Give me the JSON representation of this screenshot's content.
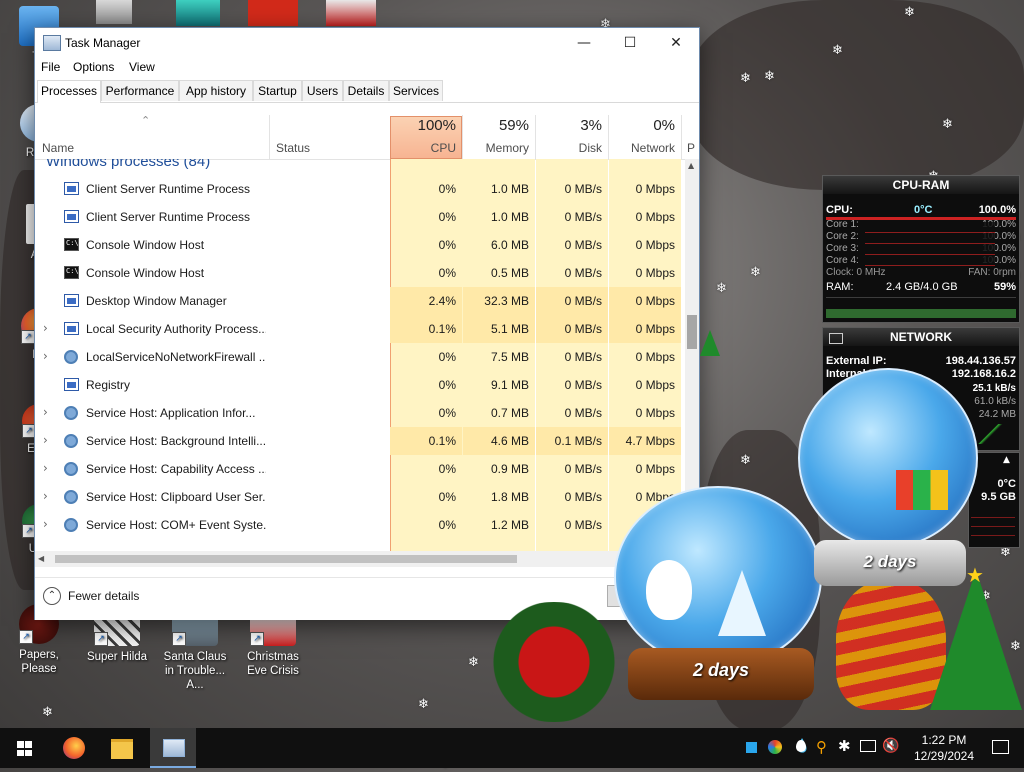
{
  "desktop": {
    "icons": [
      {
        "label": "Th",
        "name": "this-pc"
      },
      {
        "label": "Recy",
        "name": "recycle-bin"
      },
      {
        "label": "Act",
        "name": "activate"
      },
      {
        "label": "Fir",
        "name": "firefox"
      },
      {
        "label": "Ever",
        "name": "everything"
      },
      {
        "label": "Unc",
        "name": "unc"
      },
      {
        "label": "Papers, Please",
        "name": "papers-please"
      },
      {
        "label": "Super Hilda",
        "name": "super-hilda"
      },
      {
        "label": "Santa Claus in Trouble... A...",
        "name": "santa-claus-in-trouble"
      },
      {
        "label": "Christmas Eve Crisis",
        "name": "christmas-eve-crisis"
      }
    ]
  },
  "task_manager": {
    "title": "Task Manager",
    "menu": [
      "File",
      "Options",
      "View"
    ],
    "tabs": [
      "Processes",
      "Performance",
      "App history",
      "Startup",
      "Users",
      "Details",
      "Services"
    ],
    "active_tab": "Processes",
    "columns": {
      "name": "Name",
      "status": "Status",
      "cpu": {
        "pct": "100%",
        "label": "CPU"
      },
      "memory": {
        "pct": "59%",
        "label": "Memory"
      },
      "disk": {
        "pct": "3%",
        "label": "Disk"
      },
      "network": {
        "pct": "0%",
        "label": "Network"
      },
      "overflow": "P"
    },
    "group_title": "Windows processes (84)",
    "rows": [
      {
        "name": "Client Server Runtime Process",
        "icon": "window-icon",
        "expand": false,
        "cpu": "0%",
        "memory": "1.0 MB",
        "disk": "0 MB/s",
        "network": "0 Mbps"
      },
      {
        "name": "Client Server Runtime Process",
        "icon": "window-icon",
        "expand": false,
        "cpu": "0%",
        "memory": "1.0 MB",
        "disk": "0 MB/s",
        "network": "0 Mbps"
      },
      {
        "name": "Console Window Host",
        "icon": "console-icon",
        "expand": false,
        "cpu": "0%",
        "memory": "6.0 MB",
        "disk": "0 MB/s",
        "network": "0 Mbps"
      },
      {
        "name": "Console Window Host",
        "icon": "console-icon",
        "expand": false,
        "cpu": "0%",
        "memory": "0.5 MB",
        "disk": "0 MB/s",
        "network": "0 Mbps"
      },
      {
        "name": "Desktop Window Manager",
        "icon": "window-icon",
        "expand": false,
        "cpu": "2.4%",
        "memory": "32.3 MB",
        "disk": "0 MB/s",
        "network": "0 Mbps"
      },
      {
        "name": "Local Security Authority Process...",
        "icon": "window-icon",
        "expand": true,
        "cpu": "0.1%",
        "memory": "5.1 MB",
        "disk": "0 MB/s",
        "network": "0 Mbps"
      },
      {
        "name": "LocalServiceNoNetworkFirewall ...",
        "icon": "gear-icon",
        "expand": true,
        "cpu": "0%",
        "memory": "7.5 MB",
        "disk": "0 MB/s",
        "network": "0 Mbps"
      },
      {
        "name": "Registry",
        "icon": "window-icon",
        "expand": false,
        "cpu": "0%",
        "memory": "9.1 MB",
        "disk": "0 MB/s",
        "network": "0 Mbps"
      },
      {
        "name": "Service Host: Application Infor...",
        "icon": "gear-icon",
        "expand": true,
        "cpu": "0%",
        "memory": "0.7 MB",
        "disk": "0 MB/s",
        "network": "0 Mbps"
      },
      {
        "name": "Service Host: Background Intelli...",
        "icon": "gear-icon",
        "expand": true,
        "cpu": "0.1%",
        "memory": "4.6 MB",
        "disk": "0.1 MB/s",
        "network": "4.7 Mbps"
      },
      {
        "name": "Service Host: Capability Access ...",
        "icon": "gear-icon",
        "expand": true,
        "cpu": "0%",
        "memory": "0.9 MB",
        "disk": "0 MB/s",
        "network": "0 Mbps"
      },
      {
        "name": "Service Host: Clipboard User Ser...",
        "icon": "gear-icon",
        "expand": true,
        "cpu": "0%",
        "memory": "1.8 MB",
        "disk": "0 MB/s",
        "network": "0 Mbps"
      },
      {
        "name": "Service Host: COM+ Event Syste...",
        "icon": "gear-icon",
        "expand": true,
        "cpu": "0%",
        "memory": "1.2 MB",
        "disk": "0 MB/s",
        "network": "0 Mbps"
      }
    ],
    "footer": {
      "fewer_details": "Fewer details"
    }
  },
  "gadgets": {
    "cpu_ram": {
      "title": "CPU-RAM",
      "cpu_label": "CPU:",
      "cpu_temp": "0°C",
      "cpu_value": "100.0%",
      "cores": [
        {
          "label": "Core 1:",
          "value": "100.0%"
        },
        {
          "label": "Core 2:",
          "value": "100.0%"
        },
        {
          "label": "Core 3:",
          "value": "100.0%"
        },
        {
          "label": "Core 4:",
          "value": "100.0%"
        }
      ],
      "clock": "Clock: 0 MHz",
      "fan": "FAN: 0rpm",
      "ram_label": "RAM:",
      "ram_value": "2.4 GB/4.0 GB",
      "ram_pct": "59%"
    },
    "network": {
      "title": "NETWORK",
      "external_label": "External IP:",
      "external_ip": "198.44.136.57",
      "internal_label": "Internal IP:",
      "internal_ip": "192.168.16.2",
      "rate1": "25.1 kB/s",
      "rate2": "61.0 kB/s",
      "rate3": "24.2 MB"
    },
    "mini": {
      "temp": "0°C",
      "value": "9.5 GB"
    }
  },
  "snow_globes": {
    "left_label": "2 days",
    "right_label": "2 days"
  },
  "taskbar": {
    "items": [
      "start",
      "firefox",
      "file-explorer",
      "task-manager"
    ],
    "time": "1:22 PM",
    "date": "12/29/2024"
  },
  "colors": {
    "cpu_header_highlight": "#f7b492",
    "heat_light": "#fff4c4",
    "heat_mid": "#ffe9a8",
    "group_blue": "#1f4e9a",
    "taskbar": "#101010"
  }
}
